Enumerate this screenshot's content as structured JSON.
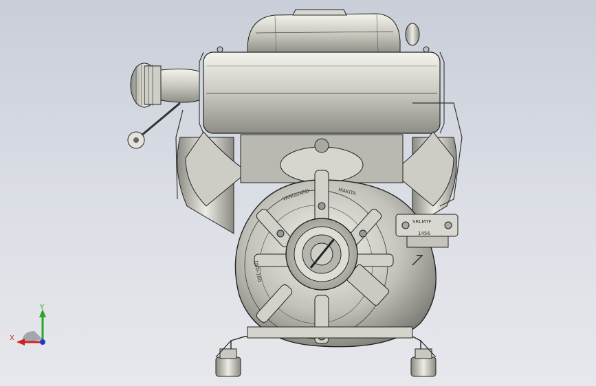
{
  "viewport": {
    "background_top": "#c9ced8",
    "background_bottom": "#e7e8ec"
  },
  "model": {
    "casting_text_left": "DSD-100",
    "casting_text_top_left": "VANGUARD",
    "casting_text_top_right": "MAKITA",
    "plate_label": "SRLMTF",
    "plate_sub": "1456"
  },
  "triad": {
    "x_label": "X",
    "y_label": "Y",
    "x_color": "#d42020",
    "y_color": "#2aa62a",
    "z_color": "#2038d0"
  }
}
